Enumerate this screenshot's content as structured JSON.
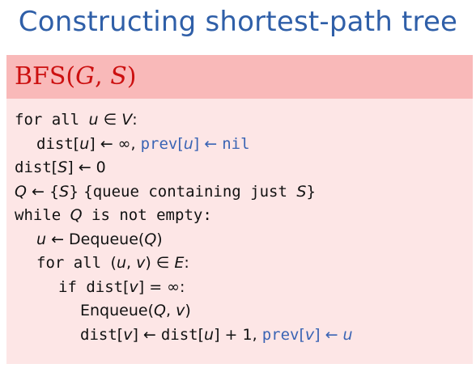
{
  "slide": {
    "title": "Constructing shortest-path tree",
    "algorithm": {
      "name": "BFS",
      "open": "(",
      "param1": "G",
      "sep": ", ",
      "param2": "S",
      "close": ")"
    }
  },
  "code": {
    "l1": {
      "kw": "for all ",
      "u": "u",
      "in": " ∈ ",
      "V": "V",
      "colon": ":"
    },
    "l2": {
      "dist": "dist",
      "lb": "[",
      "u": "u",
      "rb": "]",
      "arrow": " ← ∞, ",
      "prev": "prev",
      "lb2": "[",
      "u2": "u",
      "rb2": "]",
      "arrow2": " ← ",
      "nil": "nil"
    },
    "l3": {
      "dist": "dist",
      "lb": "[",
      "S": "S",
      "rb": "]",
      "rest": " ← 0"
    },
    "l4": {
      "Q": "Q",
      "arrow": " ← {",
      "S": "S",
      "close": "} ",
      "comment": "{queue containing just ",
      "S2": "S",
      "cclose": "}"
    },
    "l5": {
      "kw": "while ",
      "Q": "Q",
      "rest": " is not empty:"
    },
    "l6": {
      "u": "u",
      "arrow": " ← ",
      "fn": "Dequeue",
      "open": "(",
      "Q": "Q",
      "close": ")"
    },
    "l7": {
      "kw": "for all ",
      "open": "(",
      "u": "u",
      "comma": ", ",
      "v": "v",
      "close": ")",
      "in": " ∈ ",
      "E": "E",
      "colon": ":"
    },
    "l8": {
      "kw": "if ",
      "dist": "dist",
      "lb": "[",
      "v": "v",
      "rb": "]",
      "rest": " = ∞:"
    },
    "l9": {
      "fn": "Enqueue",
      "open": "(",
      "Q": "Q",
      "comma": ", ",
      "v": "v",
      "close": ")"
    },
    "l10": {
      "dist": "dist",
      "lb": "[",
      "v": "v",
      "rb": "]",
      "arrow": " ← ",
      "dist2": "dist",
      "lb2": "[",
      "u": "u",
      "rb2": "]",
      "plus": " + 1, ",
      "prev": "prev",
      "lb3": "[",
      "v2": "v",
      "rb3": "]",
      "arrow2": " ← ",
      "u2": "u"
    }
  }
}
